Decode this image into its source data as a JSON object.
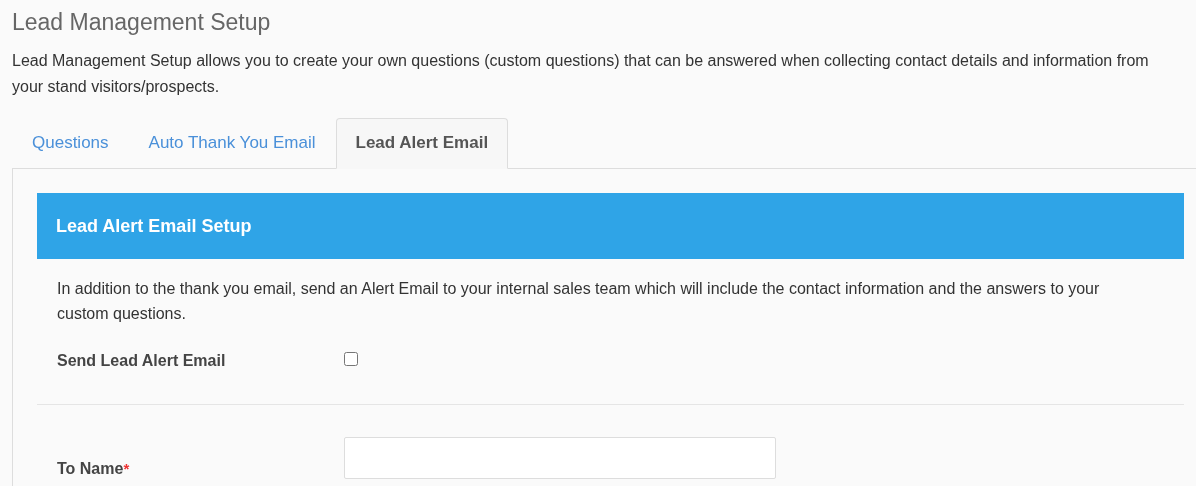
{
  "page": {
    "title": "Lead Management Setup",
    "description": "Lead Management Setup allows you to create your own questions (custom questions) that can be answered when collecting contact details and information from your stand visitors/prospects."
  },
  "tabs": [
    {
      "label": "Questions",
      "selected": false
    },
    {
      "label": "Auto Thank You Email",
      "selected": false
    },
    {
      "label": "Lead Alert Email",
      "selected": true
    }
  ],
  "panel": {
    "title": "Lead Alert Email Setup",
    "description": "In addition to the thank you email, send an Alert Email to your internal sales team which will include the contact information and the answers to your custom questions.",
    "fields": [
      {
        "kind": "checkbox",
        "label": "Send Lead Alert Email",
        "checked": false
      },
      {
        "kind": "text",
        "label": "To Name",
        "required_mark": "*"
      }
    ]
  }
}
